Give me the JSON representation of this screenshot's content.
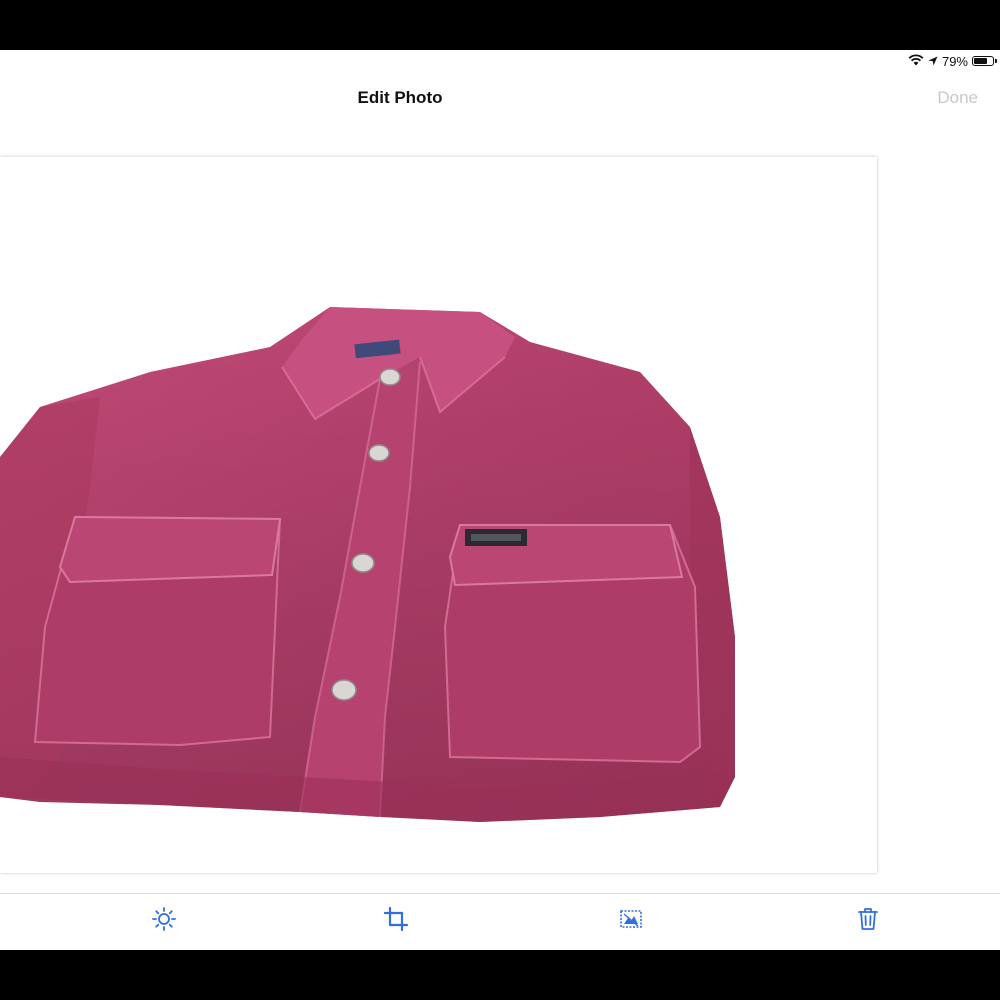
{
  "status_bar": {
    "battery_text": "79%",
    "battery_level": 0.79
  },
  "nav": {
    "title": "Edit Photo",
    "done_label": "Done"
  },
  "toolbar": {
    "tools": [
      {
        "icon": "brightness-icon"
      },
      {
        "icon": "crop-icon"
      },
      {
        "icon": "remove-background-icon"
      },
      {
        "icon": "trash-icon"
      }
    ]
  },
  "colors": {
    "accent": "#2f6fe0",
    "done_disabled": "#c8c8cc",
    "shirt": "#b8426e"
  }
}
